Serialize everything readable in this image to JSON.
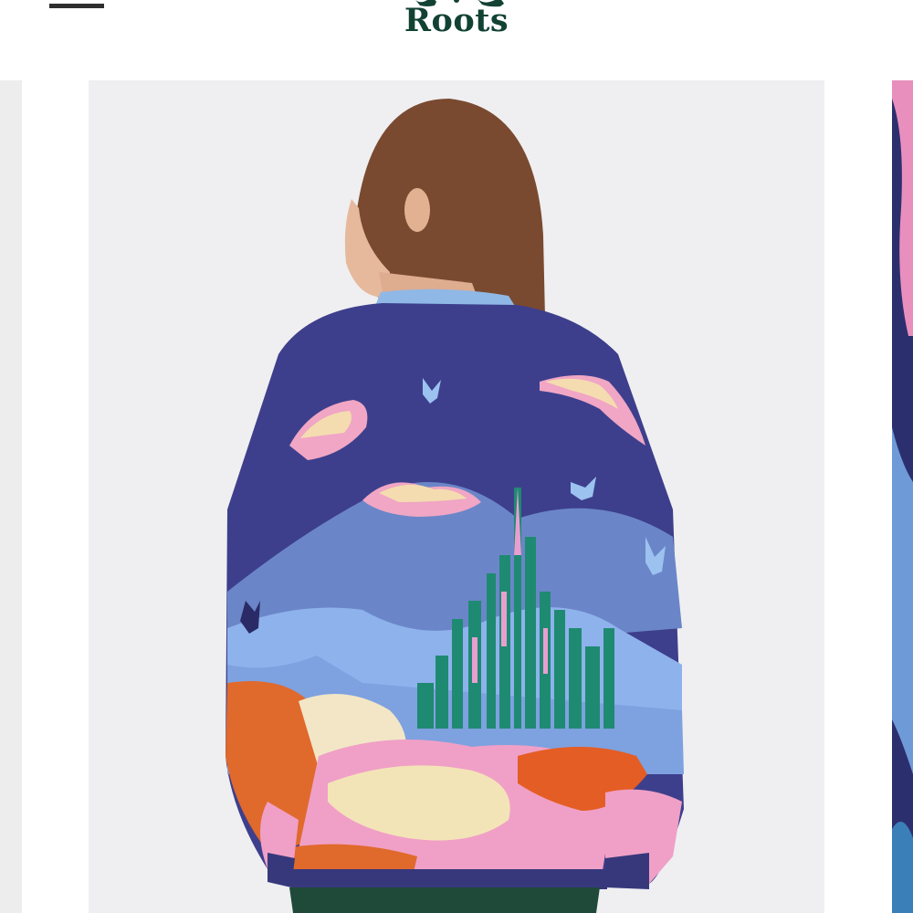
{
  "header": {
    "brand": "Roots",
    "logo_icon": "beaver-icon",
    "menu_icon": "hamburger-menu-icon"
  },
  "carousel": {
    "main_image": "cardigan-back-view-image",
    "prev_image": "previous-product-image",
    "next_image": "next-product-image"
  },
  "colors": {
    "brand_green": "#124233",
    "page_background": "#ffffff",
    "image_background": "#efeff1",
    "sweater_navy": "#3d3f8c"
  }
}
